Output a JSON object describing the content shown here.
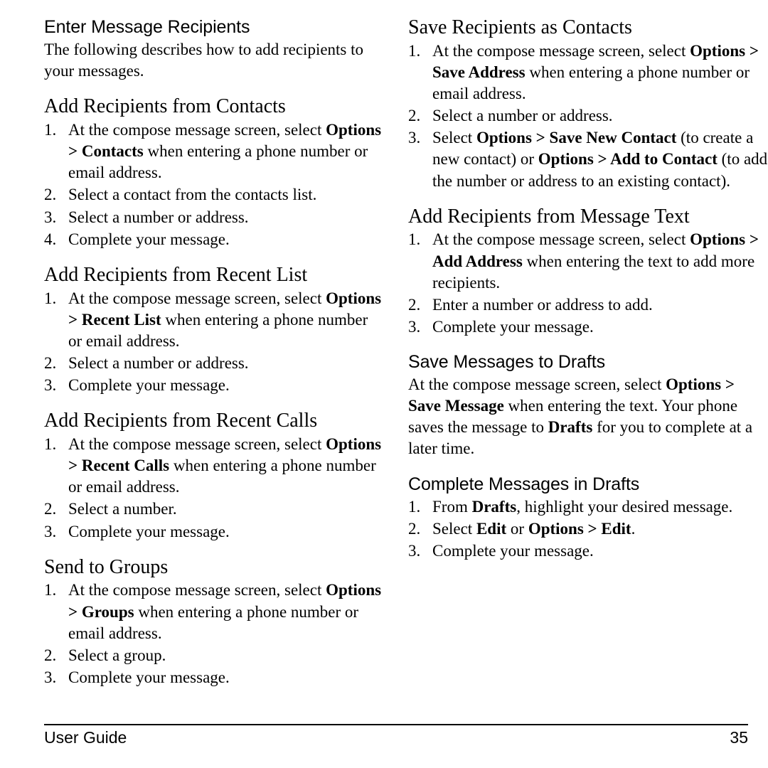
{
  "page": {
    "number": "35",
    "footer_label": "User Guide"
  },
  "left_column": {
    "sections": [
      {
        "heading": "Enter Message Recipients",
        "heading_style": "sans",
        "paragraph": "The following describes how to add recipients to your messages."
      },
      {
        "heading": "Add Recipients from Contacts",
        "heading_style": "serif",
        "steps": [
          [
            {
              "t": "At the compose message screen, select ",
              "b": false
            },
            {
              "t": "Options > Contacts",
              "b": true
            },
            {
              "t": " when entering a phone number or email address.",
              "b": false
            }
          ],
          [
            {
              "t": "Select a contact from the contacts list.",
              "b": false
            }
          ],
          [
            {
              "t": "Select a number or address.",
              "b": false
            }
          ],
          [
            {
              "t": "Complete your message.",
              "b": false
            }
          ]
        ]
      },
      {
        "heading": "Add Recipients from Recent List",
        "heading_style": "serif",
        "steps": [
          [
            {
              "t": "At the compose message screen, select ",
              "b": false
            },
            {
              "t": "Options > Recent List",
              "b": true
            },
            {
              "t": " when entering a phone number or email address.",
              "b": false
            }
          ],
          [
            {
              "t": "Select a number or address.",
              "b": false
            }
          ],
          [
            {
              "t": "Complete your message.",
              "b": false
            }
          ]
        ]
      },
      {
        "heading": "Add Recipients from Recent Calls",
        "heading_style": "serif",
        "steps": [
          [
            {
              "t": "At the compose message screen, select ",
              "b": false
            },
            {
              "t": "Options > Recent Calls",
              "b": true
            },
            {
              "t": " when entering a phone number or email address.",
              "b": false
            }
          ],
          [
            {
              "t": "Select a number.",
              "b": false
            }
          ],
          [
            {
              "t": "Complete your message.",
              "b": false
            }
          ]
        ]
      },
      {
        "heading": "Send to Groups",
        "heading_style": "serif",
        "steps": [
          [
            {
              "t": "At the compose message screen, select ",
              "b": false
            },
            {
              "t": "Options > Groups",
              "b": true
            },
            {
              "t": " when entering a phone number or email address.",
              "b": false
            }
          ],
          [
            {
              "t": "Select a group.",
              "b": false
            }
          ],
          [
            {
              "t": "Complete your message.",
              "b": false
            }
          ]
        ]
      }
    ]
  },
  "right_column": {
    "sections": [
      {
        "heading": "Save Recipients as Contacts",
        "heading_style": "serif",
        "steps": [
          [
            {
              "t": "At the compose message screen, select ",
              "b": false
            },
            {
              "t": "Options > Save Address",
              "b": true
            },
            {
              "t": " when entering a phone number or email address.",
              "b": false
            }
          ],
          [
            {
              "t": "Select a number or address.",
              "b": false
            }
          ],
          [
            {
              "t": "Select ",
              "b": false
            },
            {
              "t": "Options > Save New Contact",
              "b": true
            },
            {
              "t": " (to create a new contact) or ",
              "b": false
            },
            {
              "t": "Options > Add to Contact",
              "b": true
            },
            {
              "t": " (to add the number or address to an existing contact).",
              "b": false
            }
          ]
        ]
      },
      {
        "heading": "Add Recipients from Message Text",
        "heading_style": "serif",
        "steps": [
          [
            {
              "t": "At the compose message screen, select ",
              "b": false
            },
            {
              "t": "Options > Add Address",
              "b": true
            },
            {
              "t": " when entering the text to add more recipients.",
              "b": false
            }
          ],
          [
            {
              "t": "Enter a number or address to add.",
              "b": false
            }
          ],
          [
            {
              "t": "Complete your message.",
              "b": false
            }
          ]
        ]
      },
      {
        "heading": "Save Messages to Drafts",
        "heading_style": "sans",
        "rich_paragraph": [
          {
            "t": "At the compose message screen, select ",
            "b": false
          },
          {
            "t": "Options > Save Message",
            "b": true
          },
          {
            "t": " when entering the text. Your phone saves the message to ",
            "b": false
          },
          {
            "t": "Drafts",
            "b": true
          },
          {
            "t": " for you to complete at a later time.",
            "b": false
          }
        ]
      },
      {
        "heading": "Complete Messages in Drafts",
        "heading_style": "sans",
        "steps": [
          [
            {
              "t": "From ",
              "b": false
            },
            {
              "t": "Drafts",
              "b": true
            },
            {
              "t": ", highlight your desired message.",
              "b": false
            }
          ],
          [
            {
              "t": "Select ",
              "b": false
            },
            {
              "t": "Edit",
              "b": true
            },
            {
              "t": " or ",
              "b": false
            },
            {
              "t": "Options > Edit",
              "b": true
            },
            {
              "t": ".",
              "b": false
            }
          ],
          [
            {
              "t": "Complete your message.",
              "b": false
            }
          ]
        ]
      }
    ]
  }
}
